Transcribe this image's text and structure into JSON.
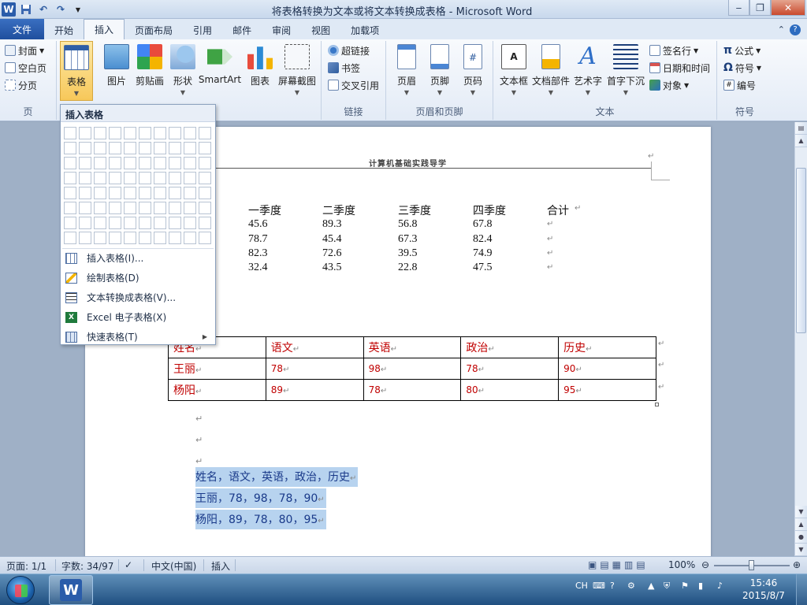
{
  "window": {
    "title": "将表格转换为文本或将文本转换成表格 - Microsoft Word",
    "qat_undo": "↶",
    "qat_redo": "↷"
  },
  "tabs": [
    {
      "label": "文件"
    },
    {
      "label": "开始"
    },
    {
      "label": "插入"
    },
    {
      "label": "页面布局"
    },
    {
      "label": "引用"
    },
    {
      "label": "邮件"
    },
    {
      "label": "审阅"
    },
    {
      "label": "视图"
    },
    {
      "label": "加载项"
    }
  ],
  "ribbon": {
    "pages": {
      "cover": "封面",
      "blank": "空白页",
      "break": "分页",
      "label": "页"
    },
    "table": {
      "label": "表格"
    },
    "illustrations": {
      "picture": "图片",
      "clipart": "剪贴画",
      "shapes": "形状",
      "smartart": "SmartArt",
      "chart": "图表",
      "screenshot": "屏幕截图"
    },
    "links": {
      "hyperlink": "超链接",
      "bookmark": "书签",
      "crossref": "交叉引用",
      "label": "链接"
    },
    "header_footer": {
      "header": "页眉",
      "footer": "页脚",
      "pagenum": "页码",
      "label": "页眉和页脚"
    },
    "text": {
      "textbox": "文本框",
      "quickparts": "文档部件",
      "wordart": "艺术字",
      "dropcap": "首字下沉",
      "signature": "签名行",
      "datetime": "日期和时间",
      "object": "对象",
      "label": "文本"
    },
    "symbols": {
      "equation": "公式",
      "symbol": "符号",
      "numbering": "编号",
      "label": "符号"
    }
  },
  "dropdown": {
    "title": "插入表格",
    "items": [
      {
        "label": "插入表格(I)..."
      },
      {
        "label": "绘制表格(D)"
      },
      {
        "label": "文本转换成表格(V)..."
      },
      {
        "label": "Excel 电子表格(X)"
      },
      {
        "label": "快速表格(T)"
      }
    ]
  },
  "document": {
    "header": "计算机基础实践导学",
    "quarter_headers": [
      "一季度",
      "二季度",
      "三季度",
      "四季度",
      "合计"
    ],
    "quarter_rows": [
      [
        "45.6",
        "89.3",
        "56.8",
        "67.8"
      ],
      [
        "78.7",
        "45.4",
        "67.3",
        "82.4"
      ],
      [
        "82.3",
        "72.6",
        "39.5",
        "74.9"
      ],
      [
        "32.4",
        "43.5",
        "22.8",
        "47.5"
      ]
    ],
    "score_table": {
      "headers": [
        "姓名",
        "语文",
        "英语",
        "政治",
        "历史"
      ],
      "rows": [
        [
          "王丽",
          "78",
          "98",
          "78",
          "90"
        ],
        [
          "杨阳",
          "89",
          "78",
          "80",
          "95"
        ]
      ]
    },
    "selected_lines": [
      "姓名，语文，英语，政治，历史",
      "王丽，78，98，78，90",
      "杨阳，89，78，80，95"
    ]
  },
  "statusbar": {
    "page": "页面: 1/1",
    "words": "字数: 34/97",
    "language": "中文(中国)",
    "mode": "插入",
    "zoom": "100%"
  },
  "taskbar": {
    "ime": "CH",
    "time": "15:46",
    "date": "2015/8/7"
  }
}
